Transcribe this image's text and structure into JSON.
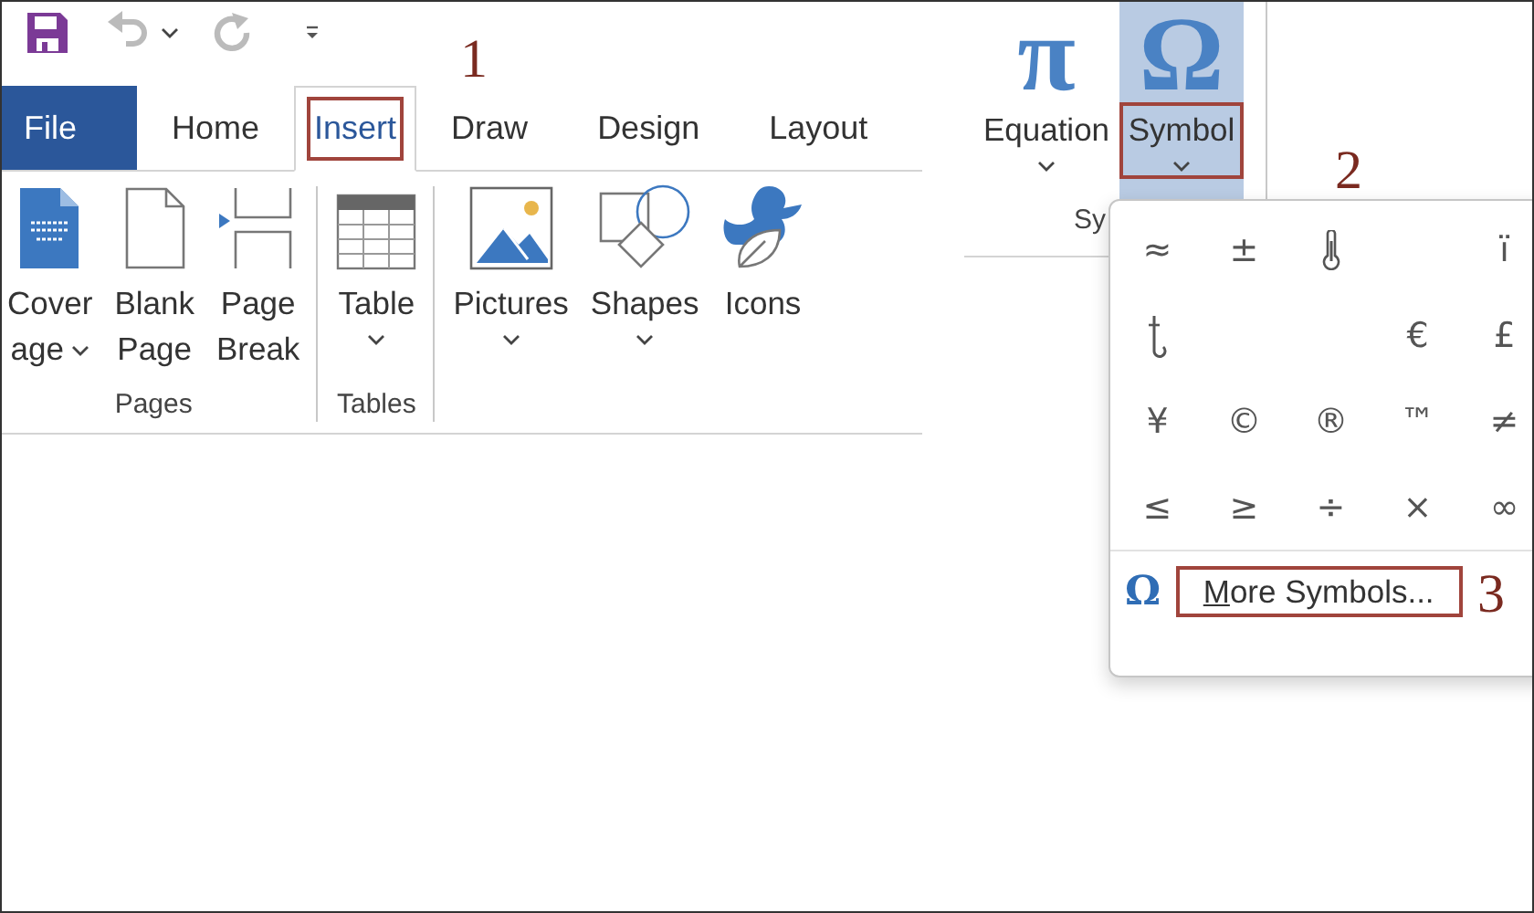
{
  "tabs": [
    {
      "label": "File",
      "kind": "backstage",
      "selected": false,
      "highlighted": false
    },
    {
      "label": "Home",
      "kind": "tab",
      "selected": false,
      "highlighted": false
    },
    {
      "label": "Insert",
      "kind": "tab",
      "selected": true,
      "highlighted": true
    },
    {
      "label": "Draw",
      "kind": "tab",
      "selected": false,
      "highlighted": false
    },
    {
      "label": "Design",
      "kind": "tab",
      "selected": false,
      "highlighted": false
    },
    {
      "label": "Layout",
      "kind": "tab",
      "selected": false,
      "highlighted": false
    }
  ],
  "ribbon": {
    "groups": [
      {
        "label": "Pages",
        "buttons": [
          {
            "kind": "cover-page",
            "label_lines": [
              "Cover",
              "age"
            ],
            "dropdown": true,
            "dropdown_inline": true
          },
          {
            "kind": "blank-page",
            "label_lines": [
              "Blank",
              "Page"
            ]
          },
          {
            "kind": "page-break",
            "label_lines": [
              "Page",
              "Break"
            ]
          }
        ]
      },
      {
        "label": "Tables",
        "buttons": [
          {
            "kind": "table",
            "label_lines": [
              "Table"
            ],
            "dropdown": true,
            "dropdown_inline": false
          }
        ]
      },
      {
        "buttons": [
          {
            "kind": "pictures",
            "label_lines": [
              "Pictures"
            ],
            "dropdown": true,
            "dropdown_inline": false
          },
          {
            "kind": "shapes",
            "label_lines": [
              "Shapes"
            ],
            "dropdown": true,
            "dropdown_inline": false
          },
          {
            "kind": "icons",
            "label_lines": [
              "Icons"
            ]
          }
        ]
      }
    ]
  },
  "symbols_group": {
    "label": "Sy",
    "buttons": [
      {
        "glyph": "π",
        "label": "Equation",
        "selected": false,
        "highlighted": false
      },
      {
        "glyph": "Ω",
        "label": "Symbol",
        "selected": true,
        "highlighted": true
      }
    ]
  },
  "symbol_gallery": {
    "cells": [
      {
        "kind": "char",
        "text": "≈"
      },
      {
        "kind": "char",
        "text": "±"
      },
      {
        "kind": "thermometer"
      },
      {
        "kind": "blank"
      },
      {
        "kind": "char",
        "text": "ï"
      },
      {
        "kind": "hook"
      },
      {
        "kind": "blank"
      },
      {
        "kind": "blank"
      },
      {
        "kind": "char",
        "text": "€"
      },
      {
        "kind": "char",
        "text": "£"
      },
      {
        "kind": "char",
        "text": "¥"
      },
      {
        "kind": "char",
        "text": "©"
      },
      {
        "kind": "char",
        "text": "®"
      },
      {
        "kind": "char",
        "text": "™"
      },
      {
        "kind": "char",
        "text": "≠"
      },
      {
        "kind": "char",
        "text": "≤"
      },
      {
        "kind": "char",
        "text": "≥"
      },
      {
        "kind": "char",
        "text": "÷"
      },
      {
        "kind": "char",
        "text": "×"
      },
      {
        "kind": "char",
        "text": "∞"
      }
    ],
    "more_glyph": "Ω",
    "more_label": "More Symbols...",
    "access_key_underlined": true,
    "more_highlighted": true
  },
  "annotations": [
    {
      "text": "1"
    },
    {
      "text": "2"
    },
    {
      "text": "3"
    }
  ]
}
